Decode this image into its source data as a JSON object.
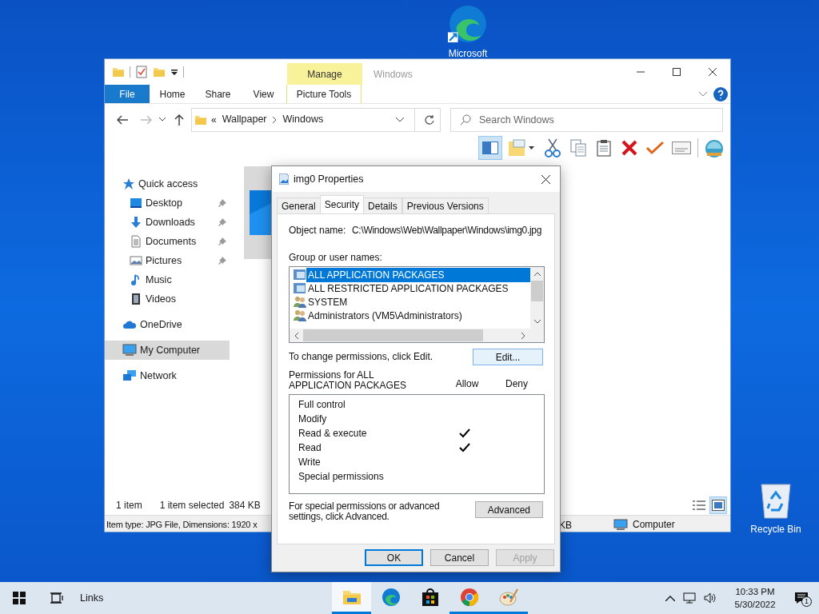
{
  "desktop_icons": [
    {
      "kind": "edge",
      "label": "Microsoft"
    },
    {
      "kind": "recycle",
      "label": "Recycle Bin"
    }
  ],
  "explorer": {
    "title": "Windows",
    "context_group": "Manage",
    "ribbon_tabs": [
      {
        "kind": "file",
        "label": "File"
      },
      {
        "kind": "tab",
        "label": "Home"
      },
      {
        "kind": "tab",
        "label": "Share"
      },
      {
        "kind": "tab",
        "label": "View"
      },
      {
        "kind": "context",
        "label": "Picture Tools"
      }
    ],
    "address": {
      "overflow": "«",
      "crumbs": [
        "Wallpaper",
        "Windows"
      ]
    },
    "search": {
      "placeholder": "Search Windows"
    },
    "sidebar": [
      {
        "kind": "star",
        "label": "Quick access",
        "selected": false,
        "children": [
          {
            "kind": "desktop",
            "label": "Desktop",
            "pinned": true,
            "selected": false
          },
          {
            "kind": "download",
            "label": "Downloads",
            "pinned": true,
            "selected": false
          },
          {
            "kind": "document",
            "label": "Documents",
            "pinned": true,
            "selected": false
          },
          {
            "kind": "pictures",
            "label": "Pictures",
            "pinned": true,
            "selected": false
          },
          {
            "kind": "music",
            "label": "Music",
            "pinned": false,
            "selected": false
          },
          {
            "kind": "videos",
            "label": "Videos",
            "pinned": false,
            "selected": false
          }
        ]
      },
      {
        "kind": "cloud",
        "label": "OneDrive",
        "selected": false
      },
      {
        "kind": "computer",
        "label": "My Computer",
        "selected": true
      },
      {
        "kind": "network",
        "label": "Network",
        "selected": false
      }
    ],
    "status": {
      "count": "1 item",
      "selected": "1 item selected",
      "size": "384 KB"
    },
    "view_buttons": [
      {
        "kind": "details",
        "selected": false
      },
      {
        "kind": "large",
        "selected": true
      }
    ],
    "details_bar": {
      "info": "Item type: JPG File, Dimensions: 1920 x",
      "size": "KB",
      "location": "Computer"
    }
  },
  "dialog": {
    "title": "img0 Properties",
    "tabs": [
      {
        "label": "General",
        "selected": false
      },
      {
        "label": "Security",
        "selected": true
      },
      {
        "label": "Details",
        "selected": false
      },
      {
        "label": "Previous Versions",
        "selected": false
      }
    ],
    "object_label": "Object name:",
    "object_value": "C:\\Windows\\Web\\Wallpaper\\Windows\\img0.jpg",
    "groups_label": "Group or user names:",
    "groups": [
      {
        "kind": "package",
        "label": "ALL APPLICATION PACKAGES",
        "selected": true
      },
      {
        "kind": "package",
        "label": "ALL RESTRICTED APPLICATION PACKAGES",
        "selected": false
      },
      {
        "kind": "users",
        "label": "SYSTEM",
        "selected": false
      },
      {
        "kind": "users",
        "label": "Administrators (VM5\\Administrators)",
        "selected": false
      }
    ],
    "edit_hint": "To change permissions, click Edit.",
    "edit_button": "Edit...",
    "permissions_label": "Permissions for ALL APPLICATION PACKAGES",
    "allow_label": "Allow",
    "deny_label": "Deny",
    "permissions": [
      {
        "label": "Full control",
        "allow": false,
        "deny": false
      },
      {
        "label": "Modify",
        "allow": false,
        "deny": false
      },
      {
        "label": "Read & execute",
        "allow": true,
        "deny": false
      },
      {
        "label": "Read",
        "allow": true,
        "deny": false
      },
      {
        "label": "Write",
        "allow": false,
        "deny": false
      },
      {
        "label": "Special permissions",
        "allow": false,
        "deny": false
      }
    ],
    "advanced_hint": "For special permissions or advanced settings, click Advanced.",
    "advanced_button": "Advanced",
    "buttons": [
      {
        "label": "OK",
        "kind": "default",
        "disabled": false
      },
      {
        "label": "Cancel",
        "kind": "normal",
        "disabled": false
      },
      {
        "label": "Apply",
        "kind": "normal",
        "disabled": true
      }
    ]
  },
  "taskbar": {
    "links": "Links",
    "apps": [
      {
        "kind": "explorer",
        "open": true
      },
      {
        "kind": "edge",
        "open": false
      },
      {
        "kind": "store",
        "open": false
      },
      {
        "kind": "chrome",
        "open": true
      },
      {
        "kind": "paint",
        "open": true
      }
    ],
    "time": "10:33 PM",
    "date": "5/30/2022",
    "notifications": "1"
  }
}
